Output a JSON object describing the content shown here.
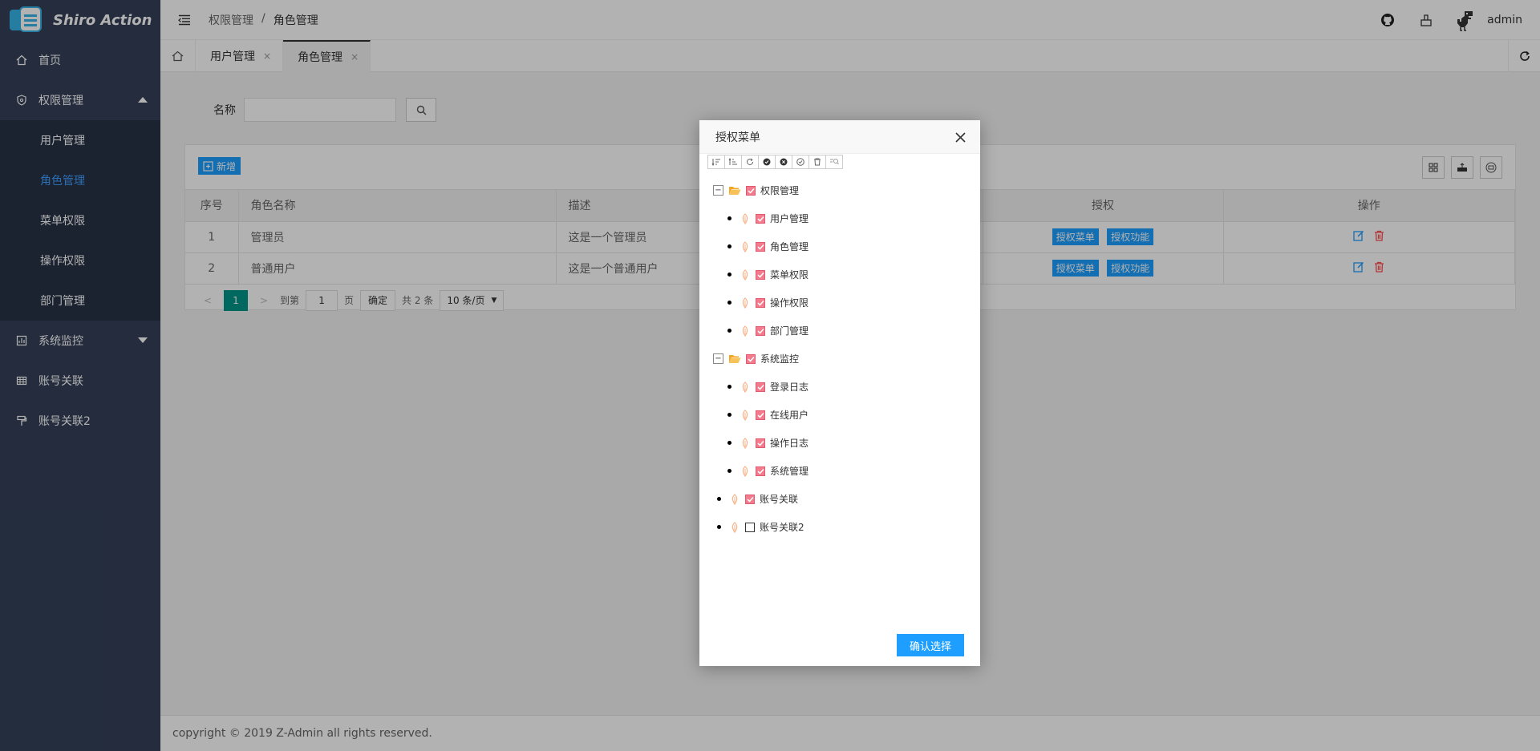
{
  "app": {
    "title": "Shiro Action"
  },
  "sidebar": {
    "home": "首页",
    "perm": "权限管理",
    "perm_items": [
      "用户管理",
      "角色管理",
      "菜单权限",
      "操作权限",
      "部门管理"
    ],
    "monitor": "系统监控",
    "account": "账号关联",
    "account2": "账号关联2"
  },
  "header": {
    "breadcrumb": [
      "权限管理",
      "角色管理"
    ],
    "separator": "/",
    "user": "admin"
  },
  "tabs": [
    {
      "label": "用户管理",
      "close": "×"
    },
    {
      "label": "角色管理",
      "close": "×"
    }
  ],
  "search": {
    "label": "名称",
    "value": ""
  },
  "table": {
    "add_label": "新增",
    "headers": [
      "序号",
      "角色名称",
      "描述",
      "授权",
      "操作"
    ],
    "rows": [
      {
        "no": "1",
        "name": "管理员",
        "desc": "这是一个管理员"
      },
      {
        "no": "2",
        "name": "普通用户",
        "desc": "这是一个普通用户"
      }
    ],
    "btn_menu": "授权菜单",
    "btn_func": "授权功能"
  },
  "pager": {
    "current": "1",
    "goto_label": "到第",
    "goto_value": "1",
    "page_label": "页",
    "confirm": "确定",
    "total": "共 2 条",
    "size": "10 条/页"
  },
  "footer": {
    "text": "copyright © 2019 Z-Admin all rights reserved."
  },
  "modal": {
    "title": "授权菜单",
    "confirm": "确认选择",
    "tree": [
      {
        "label": "权限管理",
        "level": 0,
        "folder": true,
        "checked": true
      },
      {
        "label": "用户管理",
        "level": 1,
        "checked": true
      },
      {
        "label": "角色管理",
        "level": 1,
        "checked": true
      },
      {
        "label": "菜单权限",
        "level": 1,
        "checked": true
      },
      {
        "label": "操作权限",
        "level": 1,
        "checked": true
      },
      {
        "label": "部门管理",
        "level": 1,
        "checked": true
      },
      {
        "label": "系统监控",
        "level": 0,
        "folder": true,
        "checked": true
      },
      {
        "label": "登录日志",
        "level": 1,
        "checked": true
      },
      {
        "label": "在线用户",
        "level": 1,
        "checked": true
      },
      {
        "label": "操作日志",
        "level": 1,
        "checked": true
      },
      {
        "label": "系统管理",
        "level": 1,
        "checked": true
      },
      {
        "label": "账号关联",
        "level": 0,
        "checked": true
      },
      {
        "label": "账号关联2",
        "level": 0,
        "checked": false
      }
    ]
  },
  "colors": {
    "accent": "#1e9fff",
    "sidebar": "#344058",
    "active_page": "#009688",
    "danger": "#ff4d4f"
  }
}
